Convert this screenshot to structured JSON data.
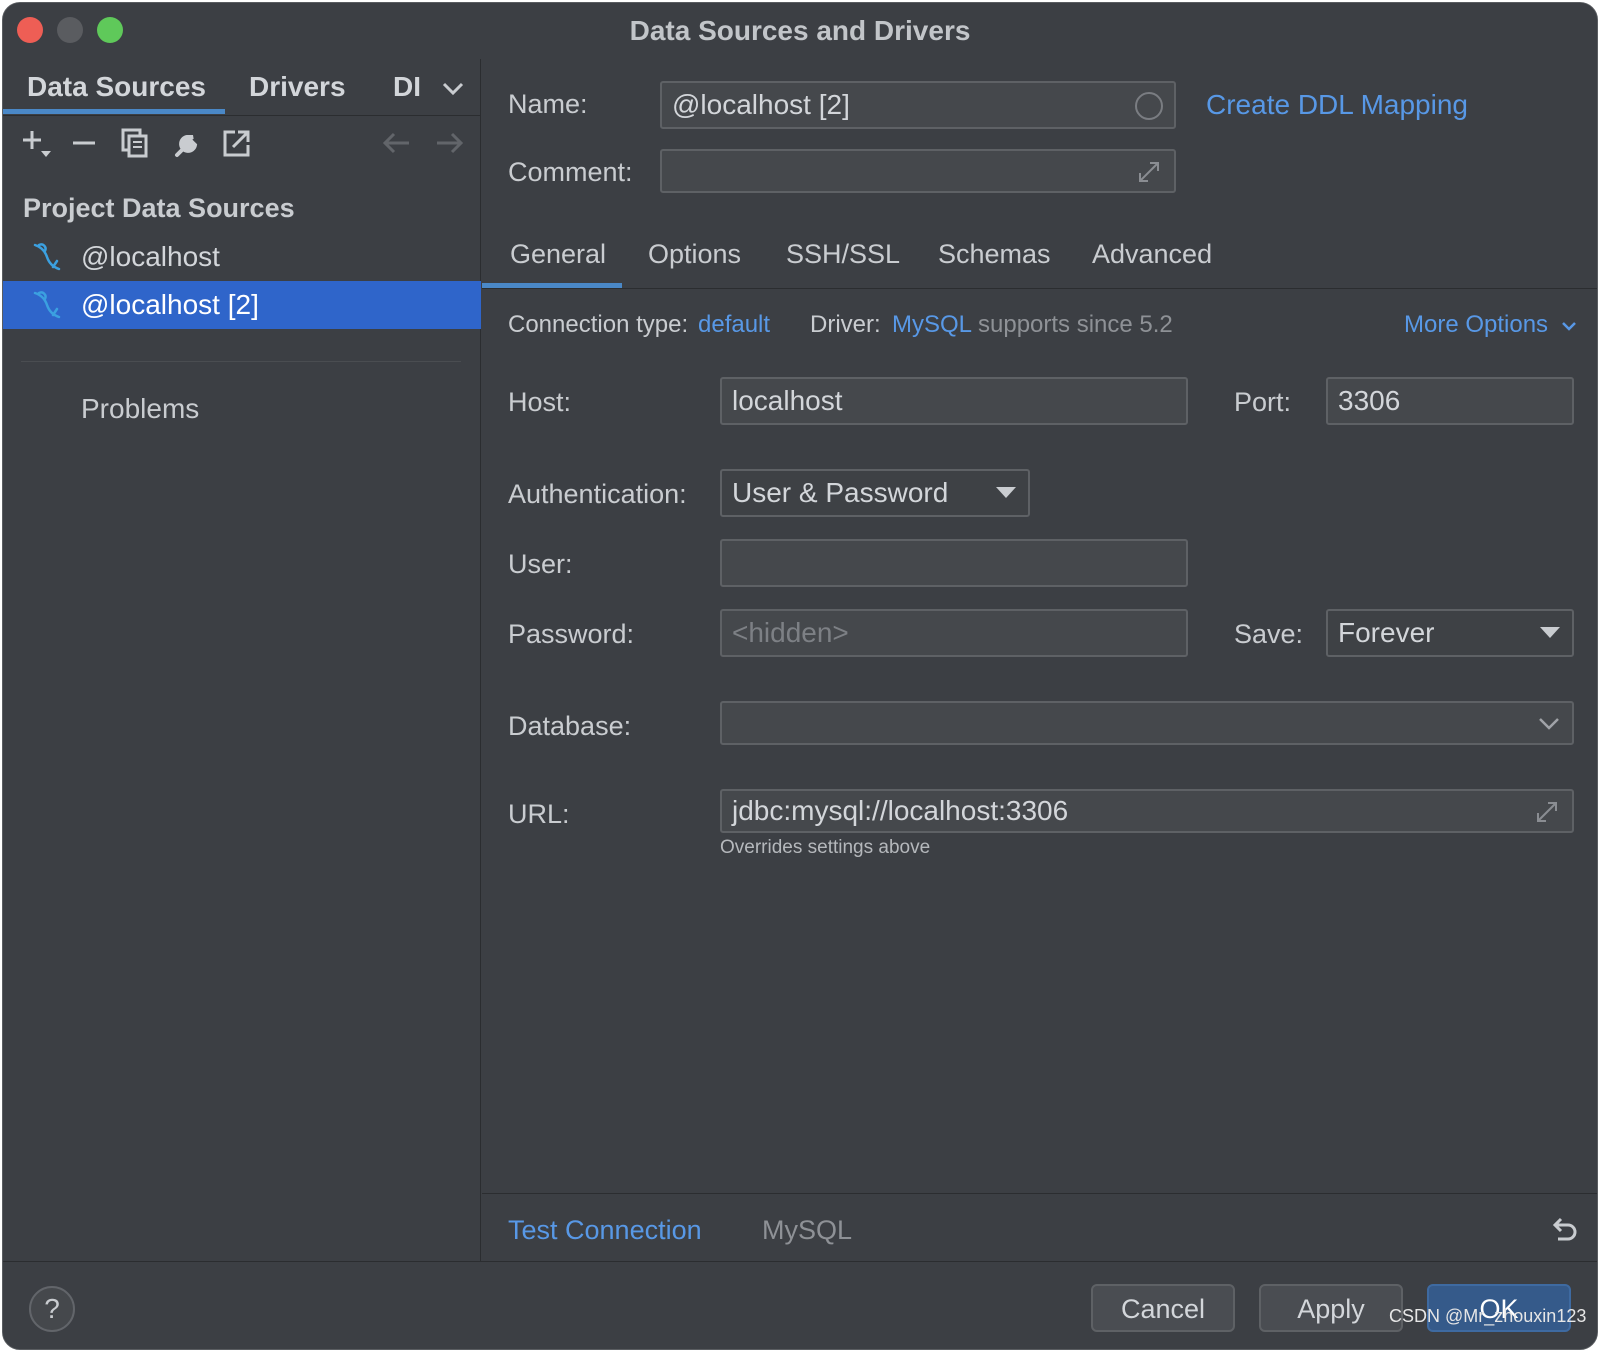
{
  "window": {
    "title": "Data Sources and Drivers"
  },
  "left": {
    "tabs": [
      "Data Sources",
      "Drivers",
      "DI"
    ],
    "section_title": "Project Data Sources",
    "items": [
      {
        "label": "@localhost",
        "selected": false
      },
      {
        "label": "@localhost [2]",
        "selected": true
      }
    ],
    "problems": "Problems"
  },
  "form": {
    "name_label": "Name:",
    "name_value": "@localhost [2]",
    "create_ddl": "Create DDL Mapping",
    "comment_label": "Comment:",
    "comment_value": "",
    "tabs": [
      "General",
      "Options",
      "SSH/SSL",
      "Schemas",
      "Advanced"
    ],
    "active_tab": "General",
    "connection_type_label": "Connection type:",
    "connection_type_value": "default",
    "driver_label": "Driver:",
    "driver_value": "MySQL",
    "driver_note": "supports since 5.2",
    "more_options": "More Options",
    "host_label": "Host:",
    "host_value": "localhost",
    "port_label": "Port:",
    "port_value": "3306",
    "auth_label": "Authentication:",
    "auth_value": "User & Password",
    "user_label": "User:",
    "user_value": "",
    "password_label": "Password:",
    "password_placeholder": "<hidden>",
    "save_label": "Save:",
    "save_value": "Forever",
    "database_label": "Database:",
    "database_value": "",
    "url_label": "URL:",
    "url_value": "jdbc:mysql://localhost:3306",
    "url_hint": "Overrides settings above",
    "test_connection": "Test Connection",
    "driver_footer": "MySQL"
  },
  "footer": {
    "help": "?",
    "cancel": "Cancel",
    "apply": "Apply",
    "ok": "OK",
    "watermark": "CSDN @Mr_zhouxin123"
  },
  "colors": {
    "accent": "#5898e6",
    "selection": "#2f65ca",
    "background": "#3c3f44"
  },
  "icons": [
    "add-icon",
    "remove-icon",
    "duplicate-icon",
    "wrench-icon",
    "export-icon",
    "back-arrow-icon",
    "forward-arrow-icon",
    "mysql-dolphin-icon",
    "expand-icon",
    "revert-icon"
  ]
}
